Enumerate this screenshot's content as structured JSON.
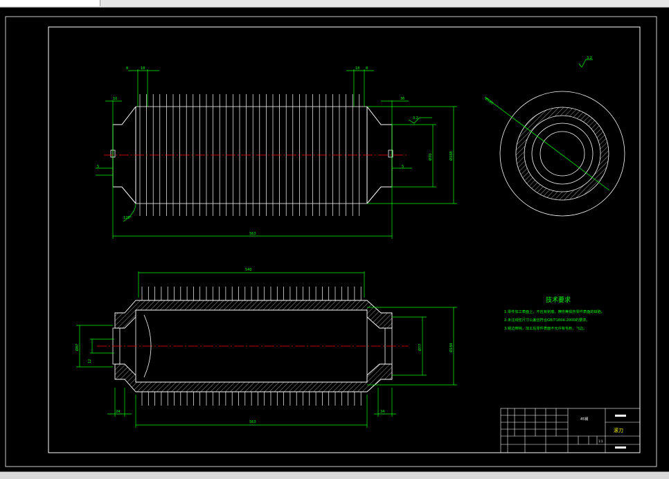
{
  "colors": {
    "background": "#000000",
    "frame": "#ffffff",
    "dimension": "#00ff00",
    "centerline": "#ff0000",
    "outline": "#ffffff",
    "text": "#ffff00"
  },
  "dims": {
    "top_left_1": "8",
    "top_left_2": "18",
    "top_right_1": "18",
    "top_right_2": "8",
    "left_small_1": "10",
    "left_small_2": "5",
    "angle": "120°",
    "right_small": "36",
    "right_inner": "5",
    "right_dia_1": "Ø70",
    "right_dia_2": "Ø188",
    "overall_len": "563",
    "bottom_top_len": "540",
    "bottom_left_a": "Ø87",
    "bottom_left_b": "12",
    "bottom_right_dia_1": "Ø77",
    "bottom_right_dia_2": "Ø184",
    "bottom_left_small": "24",
    "bottom_right_small": "34",
    "bottom_len": "563",
    "circle_dia": "Ø180"
  },
  "roughness_label": "3.2",
  "tech": {
    "title": "技术要求",
    "items": [
      "1.零件加工表面上，不应有划痕、擦伤等损伤零件表面的缺陷。",
      "2.未注线性尺寸公差应符合GB/T1804-2000的要求。",
      "3.锐边倒钝，加工后零件表面不允许有毛刺、飞边。"
    ]
  },
  "title_block": {
    "material": "45钢",
    "part_name": "滚刀",
    "scale_label": "1:1"
  }
}
